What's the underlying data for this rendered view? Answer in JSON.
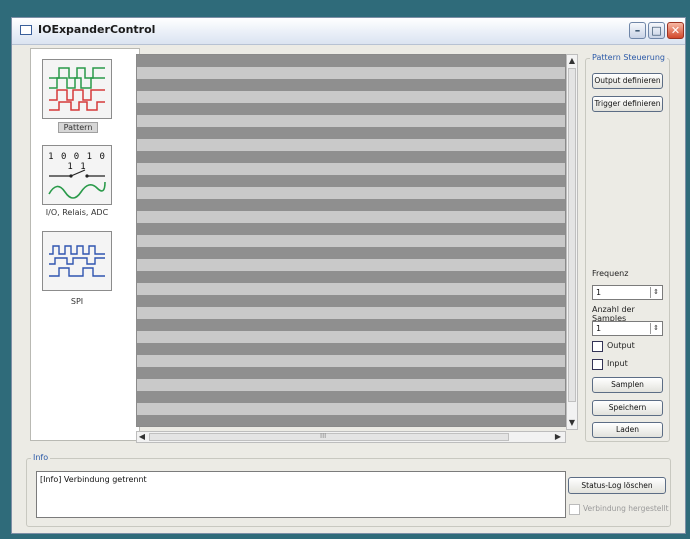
{
  "window": {
    "title": "IOExpanderControl"
  },
  "sidebar": {
    "items": [
      {
        "label": "Pattern",
        "icon": "pattern-waveform-icon"
      },
      {
        "label": "I/O, Relais, ADC",
        "icon": "io-relais-adc-icon",
        "digits": "1 0 0 1 0 1 1"
      },
      {
        "label": "SPI",
        "icon": "spi-waveform-icon"
      }
    ]
  },
  "scroll": {
    "h_center_mark": "III"
  },
  "pattern_panel": {
    "legend": "Pattern Steuerung",
    "output_btn": "Output definieren",
    "trigger_btn": "Trigger definieren",
    "frequenz_label": "Frequenz",
    "frequenz_value": "1",
    "samples_label": "Anzahl der Samples",
    "samples_value": "1",
    "output_cb": "Output",
    "input_cb": "Input",
    "samplen_btn": "Samplen",
    "speichern_btn": "Speichern",
    "laden_btn": "Laden"
  },
  "info": {
    "legend": "Info",
    "message": "[Info] Verbindung getrennt",
    "clear_btn": "Status-Log löschen",
    "connected_cb": "Verbindung hergestellt"
  },
  "colors": {
    "accent": "#2c5aa8",
    "wave_green": "#2a9a4a",
    "wave_red": "#d53a3a",
    "wave_blue": "#2f55b0"
  }
}
